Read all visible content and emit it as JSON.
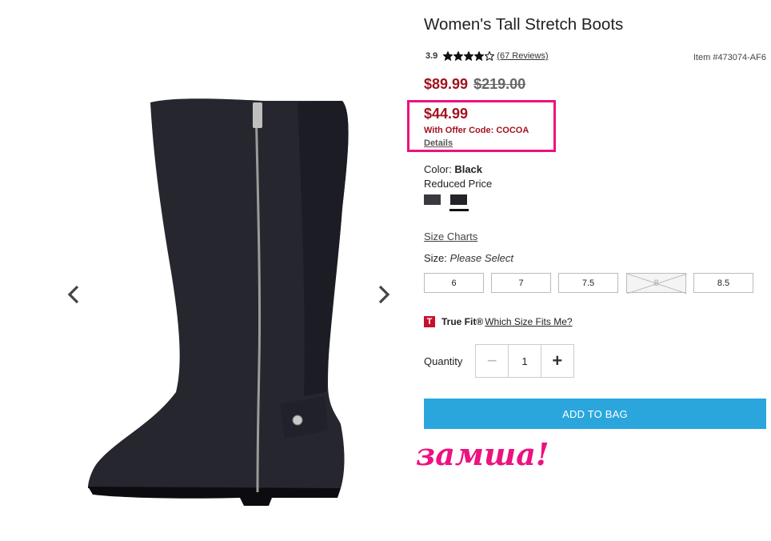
{
  "product": {
    "title": "Women's Tall Stretch Boots",
    "rating": "3.9",
    "rating_value": 3.9,
    "stars_max": 5,
    "reviews_link": "(67 Reviews)",
    "item_number": "Item #473074-AF6"
  },
  "pricing": {
    "current": "$89.99",
    "original": "$219.00",
    "offer_price": "$44.99",
    "offer_code_text": "With Offer Code: COCOA",
    "details_link": "Details"
  },
  "color": {
    "label": "Color:",
    "value": "Black",
    "note": "Reduced Price",
    "swatches": [
      "#3a3a3e",
      "#232329"
    ],
    "selected_swatch": 1
  },
  "sizes": {
    "charts_link": "Size Charts",
    "label": "Size:",
    "placeholder": "Please Select",
    "options": [
      "6",
      "7",
      "7.5",
      "8",
      "8.5"
    ],
    "unavailable": [
      "8"
    ]
  },
  "truefit": {
    "icon_letter": "T",
    "brand": "True Fit®",
    "link": "Which Size Fits Me?"
  },
  "quantity": {
    "label": "Quantity",
    "value": "1",
    "minus": "−",
    "plus": "+"
  },
  "actions": {
    "add_to_bag": "ADD TO BAG"
  },
  "annotation": {
    "handwritten": "замша!",
    "color": "#ec127f"
  },
  "colors": {
    "sale_red": "#a0131f",
    "button_blue": "#2aa6dd",
    "highlight_pink": "#ec127f"
  },
  "icons": [
    "chevron-left-icon",
    "chevron-right-icon",
    "star-icon",
    "truefit-logo-icon"
  ]
}
